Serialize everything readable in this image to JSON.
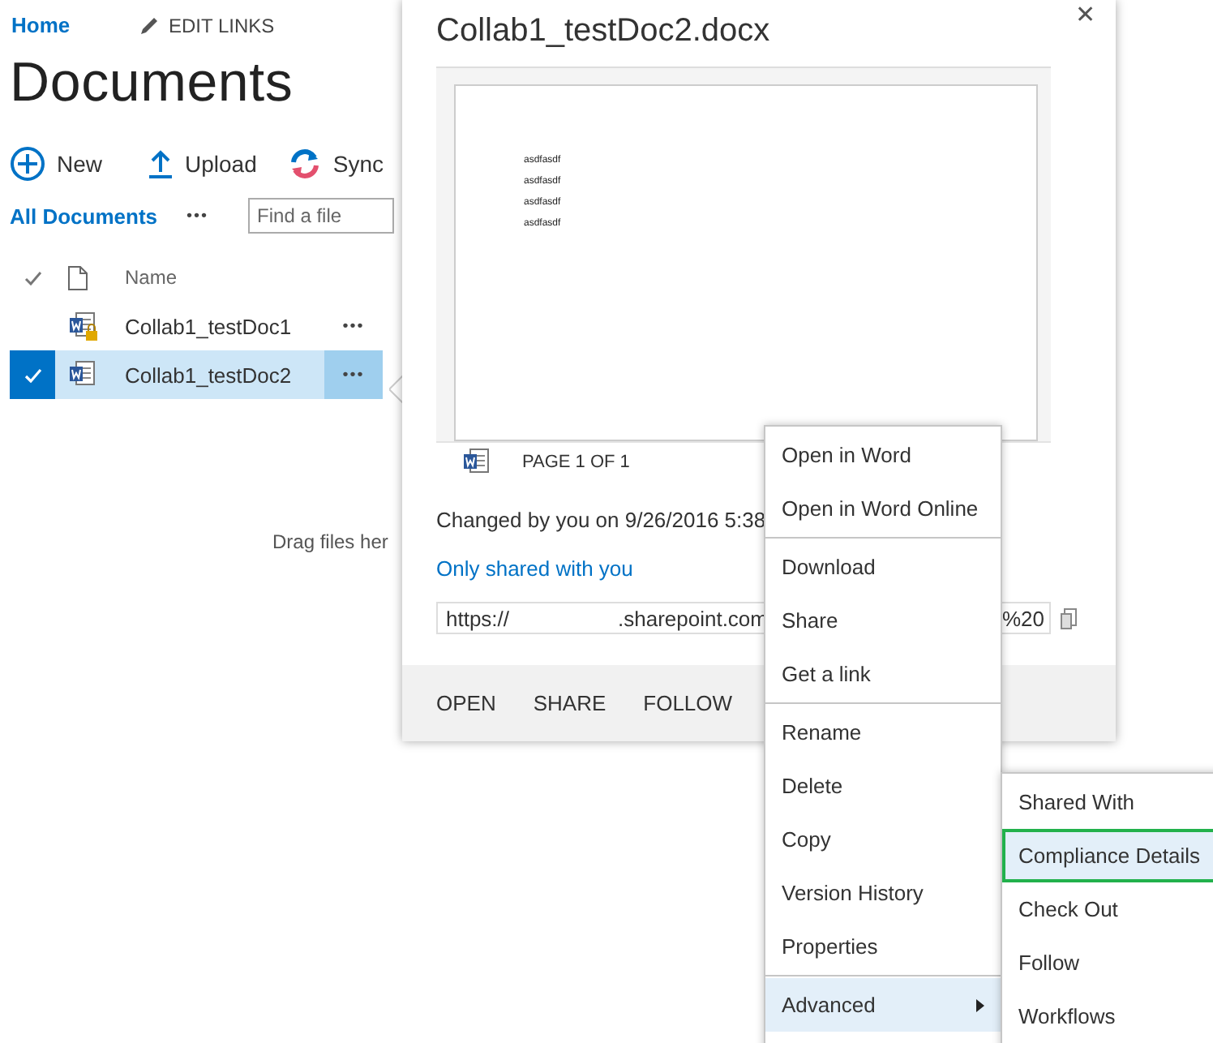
{
  "nav": {
    "home": "Home",
    "edit_links": "EDIT LINKS"
  },
  "page_title": "Documents",
  "toolbar": [
    {
      "kind": "new",
      "label": "New"
    },
    {
      "kind": "upload",
      "label": "Upload"
    },
    {
      "kind": "sync",
      "label": "Sync"
    }
  ],
  "view": {
    "label": "All Documents",
    "more": "•••",
    "search": {
      "placeholder": "Find a file"
    }
  },
  "table": {
    "columns": [
      {
        "kind": "check"
      },
      {
        "kind": "type"
      },
      {
        "kind": "text",
        "label": "Name"
      }
    ],
    "rows": [
      {
        "name": "Collab1_testDoc1",
        "locked": true,
        "selected": false,
        "more": "•••"
      },
      {
        "name": "Collab1_testDoc2",
        "locked": false,
        "selected": true,
        "more": "•••"
      }
    ]
  },
  "drop_hint": "Drag files her",
  "callout": {
    "title": "Collab1_testDoc2.docx",
    "close": "✕",
    "preview": {
      "lines": [
        "asdfasdf",
        "asdfasdf",
        "asdfasdf",
        "asdfasdf"
      ],
      "page_label": "PAGE 1 OF 1"
    },
    "changed": "Changed by you on 9/26/2016 5:38",
    "sharing": "Only shared with you",
    "url": {
      "start": "https://",
      "middle": ".sharepoint.com",
      "end": "%20"
    },
    "actions": [
      "OPEN",
      "SHARE",
      "FOLLOW"
    ]
  },
  "menu": {
    "groups": [
      [
        {
          "label": "Open in Word",
          "selected": false
        },
        {
          "label": "Open in Word Online",
          "selected": false
        }
      ],
      [
        {
          "label": "Download",
          "selected": false
        },
        {
          "label": "Share",
          "selected": false
        },
        {
          "label": "Get a link",
          "selected": false
        }
      ],
      [
        {
          "label": "Rename",
          "selected": false
        },
        {
          "label": "Delete",
          "selected": false
        },
        {
          "label": "Copy",
          "selected": false
        },
        {
          "label": "Version History",
          "selected": false
        },
        {
          "label": "Properties",
          "selected": false
        }
      ],
      [
        {
          "label": "Advanced",
          "selected": true,
          "submenu": true
        }
      ]
    ]
  },
  "submenu": {
    "items": [
      {
        "label": "Shared With",
        "selected": false,
        "annotated": false
      },
      {
        "label": "Compliance Details",
        "selected": true,
        "annotated": true
      },
      {
        "label": "Check Out",
        "selected": false,
        "annotated": false
      },
      {
        "label": "Follow",
        "selected": false,
        "annotated": false
      },
      {
        "label": "Workflows",
        "selected": false,
        "annotated": false
      }
    ]
  }
}
